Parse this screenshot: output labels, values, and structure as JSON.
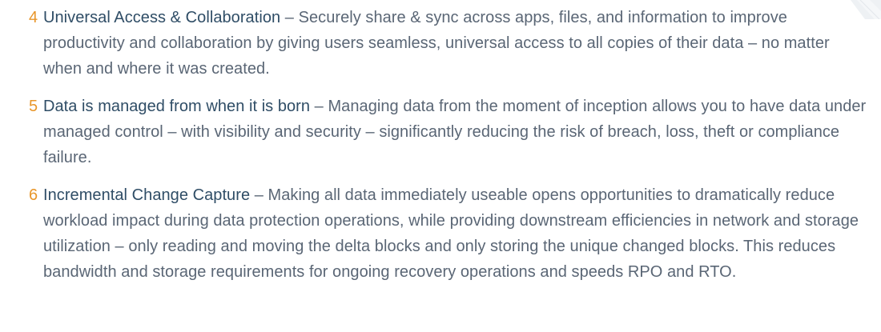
{
  "items": [
    {
      "number": "4",
      "title": "Universal Access & Collaboration",
      "separator": " – ",
      "text": "Securely share & sync across apps, files, and information to improve productivity and collaboration by giving users seamless, universal access to all copies of their data – no matter when and where it was created."
    },
    {
      "number": "5",
      "title": "Data is managed from when it is born",
      "separator": " – ",
      "text": "Managing data from the moment of inception allows you to have data under managed control – with visibility and security – significantly reducing the risk of breach, loss, theft or compliance failure."
    },
    {
      "number": "6",
      "title": "Incremental Change Capture",
      "separator": " – ",
      "text": "Making all data immediately useable opens opportunities to dramatically reduce workload impact during data protection operations, while providing downstream efficiencies in network and storage utilization – only reading and moving the delta blocks and only storing the unique changed blocks. This reduces bandwidth and storage requirements for ongoing recovery operations and speeds RPO and RTO."
    }
  ],
  "colors": {
    "number": "#e8962a",
    "title": "#2f4d66",
    "body": "#5a6675"
  }
}
